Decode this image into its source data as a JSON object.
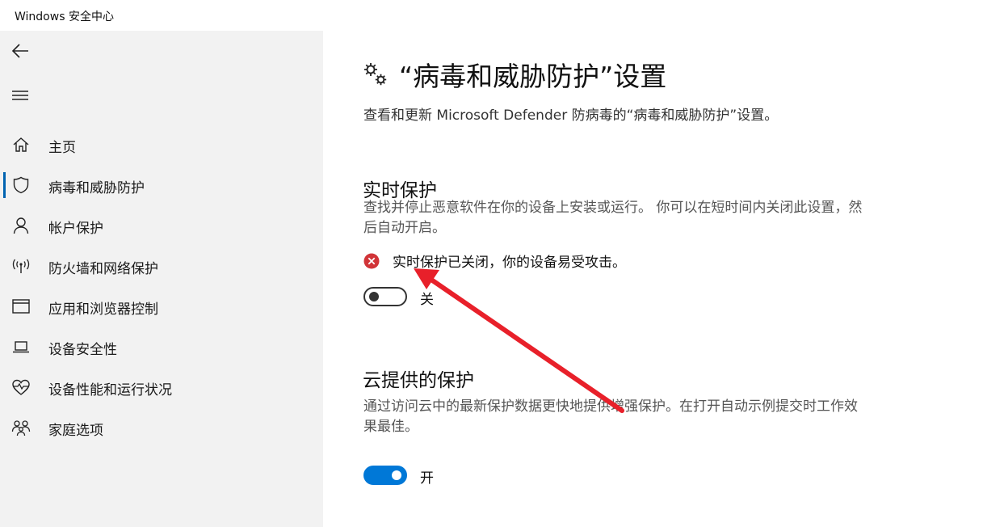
{
  "window": {
    "title": "Windows 安全中心"
  },
  "sidebar": {
    "back_icon": "back-arrow-icon",
    "menu_icon": "hamburger-menu-icon",
    "active_color": "#0063b1",
    "items": [
      {
        "label": "主页",
        "icon": "home-icon",
        "active": false
      },
      {
        "label": "病毒和威胁防护",
        "icon": "shield-icon",
        "active": true
      },
      {
        "label": "帐户保护",
        "icon": "person-icon",
        "active": false
      },
      {
        "label": "防火墙和网络保护",
        "icon": "wifi-antenna-icon",
        "active": false
      },
      {
        "label": "应用和浏览器控制",
        "icon": "app-window-icon",
        "active": false
      },
      {
        "label": "设备安全性",
        "icon": "laptop-icon",
        "active": false
      },
      {
        "label": "设备性能和运行状况",
        "icon": "heart-pulse-icon",
        "active": false
      },
      {
        "label": "家庭选项",
        "icon": "family-icon",
        "active": false
      }
    ]
  },
  "main": {
    "title_icon": "gears-icon",
    "title": "“病毒和威胁防护”设置",
    "description": "查看和更新 Microsoft Defender 防病毒的“病毒和威胁防护”设置。",
    "realtime": {
      "title": "实时保护",
      "description": "查找并停止恶意软件在你的设备上安装或运行。 你可以在短时间内关闭此设置，然后自动开启。",
      "warning_icon": "error-circle-icon",
      "warning_color": "#d13438",
      "warning_text": "实时保护已关闭，你的设备易受攻击。",
      "toggle_on": false,
      "toggle_label": "关"
    },
    "cloud": {
      "title": "云提供的保护",
      "description": "通过访问云中的最新保护数据更快地提供增强保护。在打开自动示例提交时工作效果最佳。",
      "toggle_on": true,
      "toggle_label": "开",
      "toggle_color": "#0078d7"
    }
  },
  "annotation": {
    "arrow_color": "#e8202a"
  }
}
